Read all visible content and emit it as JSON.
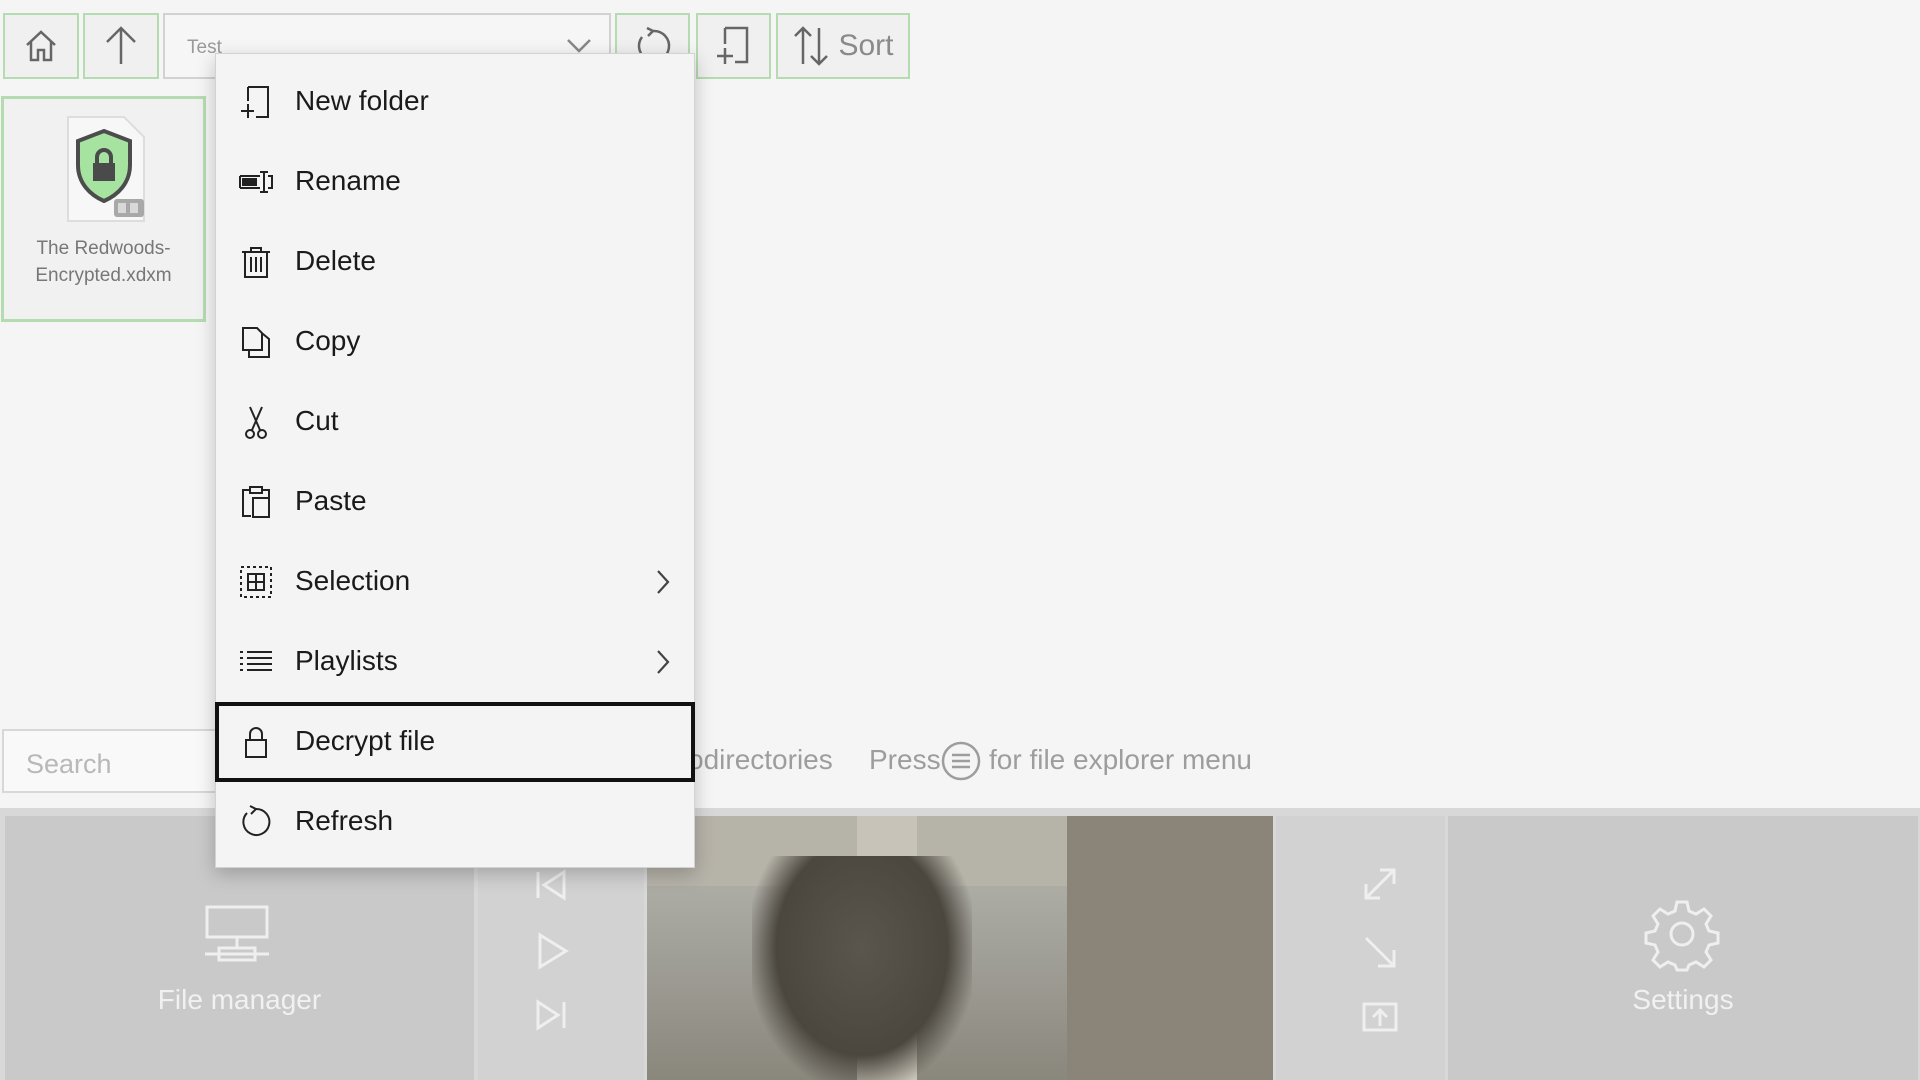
{
  "toolbar": {
    "home_icon": "home-icon",
    "up_icon": "arrow-up-icon",
    "path_value": "Test",
    "refresh_icon": "refresh-icon",
    "new_folder_icon": "new-folder-icon",
    "sort_label": "Sort"
  },
  "file": {
    "name": "The Redwoods-\nEncrypted.xdxm",
    "icon": "encrypted-file-icon"
  },
  "search": {
    "placeholder": "Search"
  },
  "status": {
    "subdirs_text": "odirectories",
    "press_text": "Press",
    "menu_hint": "for file explorer menu"
  },
  "context_menu": {
    "items": [
      {
        "label": "New folder",
        "icon": "new-folder-icon"
      },
      {
        "label": "Rename",
        "icon": "rename-icon"
      },
      {
        "label": "Delete",
        "icon": "trash-icon"
      },
      {
        "label": "Copy",
        "icon": "copy-icon"
      },
      {
        "label": "Cut",
        "icon": "scissors-icon"
      },
      {
        "label": "Paste",
        "icon": "paste-icon"
      },
      {
        "label": "Selection",
        "icon": "selection-grid-icon",
        "submenu": true
      },
      {
        "label": "Playlists",
        "icon": "list-icon",
        "submenu": true
      },
      {
        "label": "Decrypt file",
        "icon": "lock-icon",
        "focused": true
      },
      {
        "label": "Refresh",
        "icon": "refresh-icon"
      }
    ]
  },
  "bottom": {
    "file_manager_label": "File manager",
    "settings_label": "Settings"
  },
  "colors": {
    "accent_border": "#b5dbb0",
    "shield_green": "#a6e3a1",
    "focus_border": "#111111"
  }
}
